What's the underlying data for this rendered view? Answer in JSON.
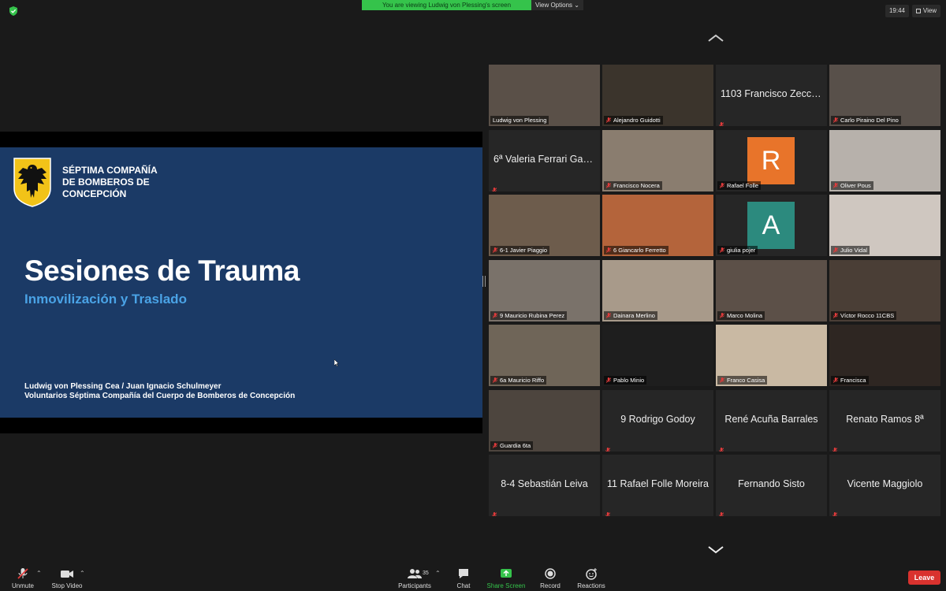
{
  "banner": {
    "text": "You are viewing Ludwig von Plessing's screen",
    "view_options": "View Options ⌄"
  },
  "top_right": {
    "clock": "19:44",
    "view_label": "View"
  },
  "slide": {
    "org_lines": [
      "SÉPTIMA COMPAÑÍA",
      "DE BOMBEROS DE",
      "CONCEPCIÓN"
    ],
    "title": "Sesiones de Trauma",
    "subtitle": "Inmovilización y Traslado",
    "authors": "Ludwig von Plessing Cea / Juan Ignacio Schulmeyer",
    "affiliation": "Voluntarios Séptima Compañía del Cuerpo de Bomberos de Concepción"
  },
  "participants": [
    {
      "name": "Ludwig von Plessing",
      "kind": "video",
      "bg": "#5a5048",
      "active": true,
      "muted": false
    },
    {
      "name": "Alejandro Guidotti",
      "kind": "video",
      "bg": "#3b342c"
    },
    {
      "name": "1103 Francisco Zecch...",
      "kind": "name"
    },
    {
      "name": "Carlo Pirainо Del Pino",
      "kind": "video",
      "bg": "#58504a"
    },
    {
      "name": "6ª Valeria Ferrari Gari...",
      "kind": "name"
    },
    {
      "name": "Francisco Nocera",
      "kind": "video",
      "bg": "#8a7d6f"
    },
    {
      "name": "Rafael Folle",
      "kind": "avatar",
      "letter": "R",
      "avatar_color": "#e8742a"
    },
    {
      "name": "Oliver Pous",
      "kind": "video",
      "bg": "#b7b1ab"
    },
    {
      "name": "6-1 Javier Piaggio",
      "kind": "video",
      "bg": "#6d5c4c"
    },
    {
      "name": "6 Giancarlo Ferretto",
      "kind": "video",
      "bg": "#b4643b"
    },
    {
      "name": "giulia pojer",
      "kind": "avatar",
      "letter": "A",
      "avatar_color": "#2c8a7e"
    },
    {
      "name": "Julio Vidal",
      "kind": "video",
      "bg": "#cfc7c0"
    },
    {
      "name": "9 Mauricio Rubina Perez",
      "kind": "video",
      "bg": "#7a726a"
    },
    {
      "name": "Dainara Merlino",
      "kind": "video",
      "bg": "#a89a8a"
    },
    {
      "name": "Marco Molina",
      "kind": "video",
      "bg": "#5c5048"
    },
    {
      "name": "Víctor Rocco 11CBS",
      "kind": "video",
      "bg": "#4a3e36"
    },
    {
      "name": "6a Mauricio Riffo",
      "kind": "video",
      "bg": "#6f6558"
    },
    {
      "name": "Pablo Minio",
      "kind": "video",
      "bg": "#1e1e1e"
    },
    {
      "name": "Franco Casisa",
      "kind": "video",
      "bg": "#c9b9a3"
    },
    {
      "name": "Francisca",
      "kind": "video",
      "bg": "#2e2622"
    },
    {
      "name": "Guardia 6ta",
      "kind": "video",
      "bg": "#4d453e"
    },
    {
      "name": "9 Rodrigo Godoy",
      "kind": "name"
    },
    {
      "name": "René Acuña Barrales",
      "kind": "name"
    },
    {
      "name": "Renato Ramos 8ª",
      "kind": "name"
    },
    {
      "name": "8-4 Sebastián Leiva",
      "kind": "name"
    },
    {
      "name": "11 Rafael Folle Moreira",
      "kind": "name"
    },
    {
      "name": "Fernando Sisto",
      "kind": "name"
    },
    {
      "name": "Vicente Maggiolo",
      "kind": "name"
    }
  ],
  "toolbar": {
    "unmute": "Unmute",
    "stop_video": "Stop Video",
    "participants": "Participants",
    "participants_count": "35",
    "chat": "Chat",
    "share_screen": "Share Screen",
    "record": "Record",
    "reactions": "Reactions",
    "leave": "Leave"
  },
  "colors": {
    "accent_green": "#35c34b",
    "leave_red": "#d9322e",
    "share_green": "#35c34b",
    "slide_blue": "#1b3a66",
    "subtitle_blue": "#4aa3e6"
  }
}
